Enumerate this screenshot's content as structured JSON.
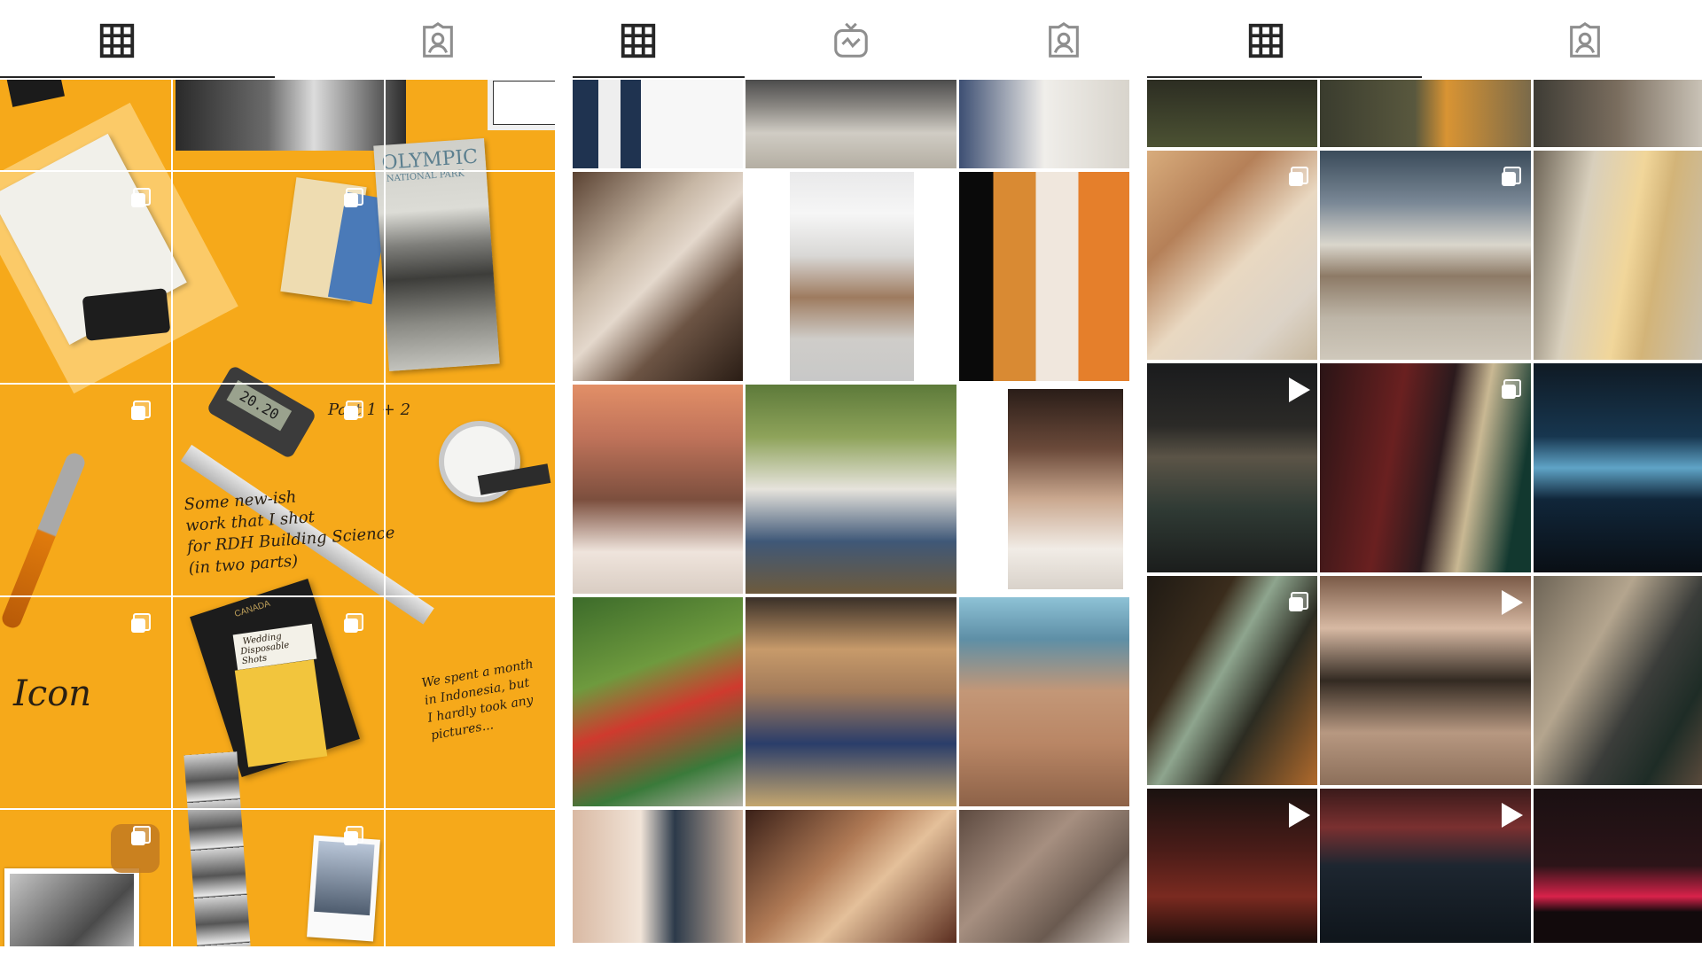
{
  "panels": [
    {
      "name": "profile-grid-1",
      "tabs": [
        "grid-icon",
        "tagged-icon"
      ]
    },
    {
      "name": "profile-grid-2",
      "tabs": [
        "grid-icon",
        "igtv-icon",
        "tagged-icon"
      ]
    },
    {
      "name": "profile-grid-3",
      "tabs": [
        "grid-icon",
        "tagged-icon"
      ]
    }
  ],
  "collage": {
    "notes": [
      "Some new-ish",
      "work that I shot",
      "for RDH Building Science",
      "(in two parts)"
    ],
    "icon_word": "Icon",
    "indonesia": [
      "We spent a month",
      "in Indonesia, but",
      "I hardly took any",
      "pictures..."
    ],
    "park": [
      "OLYMPIC",
      "NATIONAL PARK"
    ],
    "caliper_display": "20.20",
    "part_label": "Part 1 + 2",
    "passport_note": [
      "Wedding",
      "Disposable Shots"
    ],
    "passport_country": "CANADA"
  },
  "colors": {
    "accent_orange": "#f6a91a",
    "icon_dark": "#262626",
    "grid_line": "#ffffff"
  }
}
